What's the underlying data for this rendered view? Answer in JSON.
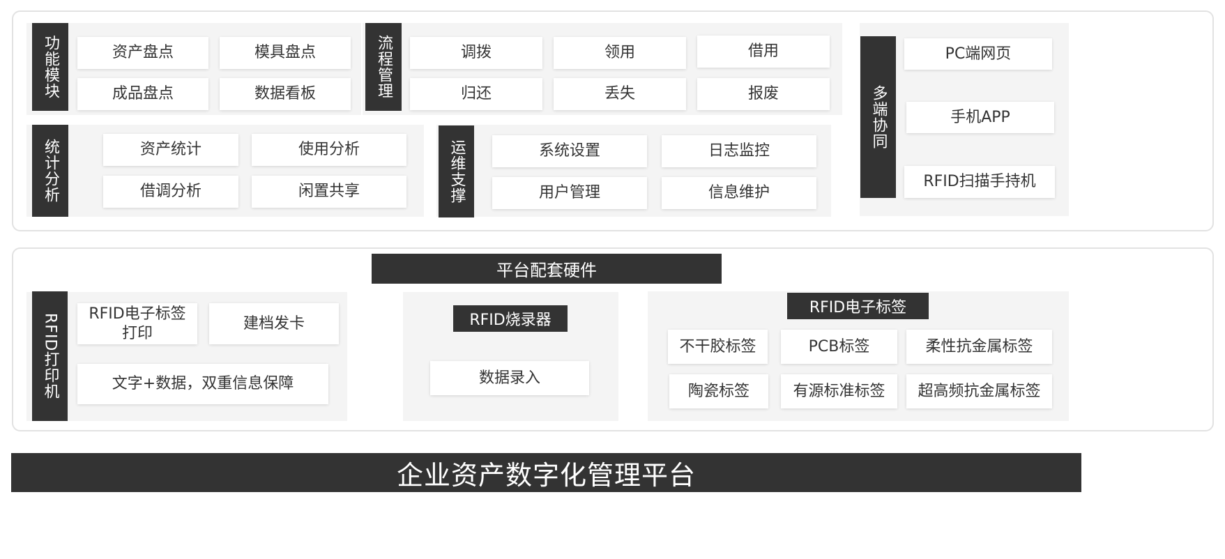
{
  "function_modules": {
    "label": "功能模块",
    "items": [
      "资产盘点",
      "模具盘点",
      "成品盘点",
      "数据看板"
    ]
  },
  "process_management": {
    "label": "流程管理",
    "items": [
      "调拨",
      "领用",
      "借用",
      "归还",
      "丢失",
      "报废"
    ]
  },
  "statistics_analysis": {
    "label": "统计分析",
    "items": [
      "资产统计",
      "使用分析",
      "借调分析",
      "闲置共享"
    ]
  },
  "ops_support": {
    "label": "运维支撑",
    "items": [
      "系统设置",
      "日志监控",
      "用户管理",
      "信息维护"
    ]
  },
  "multi_terminal": {
    "label": "多端协同",
    "items": [
      "PC端网页",
      "手机APP",
      "RFID扫描手持机"
    ]
  },
  "hardware": {
    "title": "平台配套硬件",
    "printer": {
      "label": "RFID打印机",
      "items": [
        "RFID电子标签打印",
        "建档发卡",
        "文字+数据，双重信息保障"
      ]
    },
    "encoder": {
      "title": "RFID烧录器",
      "items": [
        "数据录入"
      ]
    },
    "tags": {
      "title": "RFID电子标签",
      "items": [
        "不干胶标签",
        "PCB标签",
        "柔性抗金属标签",
        "陶瓷标签",
        "有源标准标签",
        "超高频抗金属标签"
      ]
    }
  },
  "platform": {
    "title": "企业资产数字化管理平台"
  }
}
